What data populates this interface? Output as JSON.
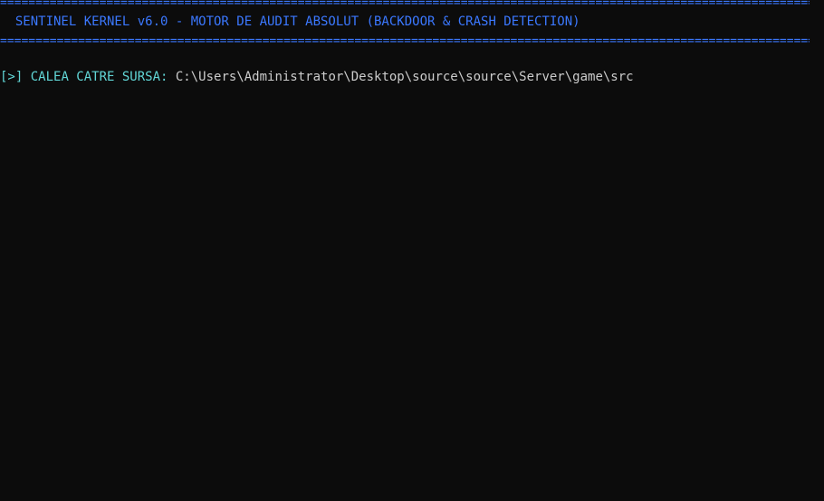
{
  "window": {
    "background": "#0c0c0c"
  },
  "banner": {
    "rule": "==============================================================================================================================",
    "title": "  SENTINEL KERNEL v6.0 - MOTOR DE AUDIT ABSOLUT (BACKDOOR & CRASH DETECTION)",
    "color": "#3b78ff"
  },
  "prompt": {
    "marker": "[>]",
    "label": " CALEA CATRE SURSA: ",
    "value": "C:\\Users\\Administrator\\Desktop\\source\\source\\Server\\game\\src",
    "label_color": "#61d6d6",
    "value_color": "#cccccc"
  }
}
